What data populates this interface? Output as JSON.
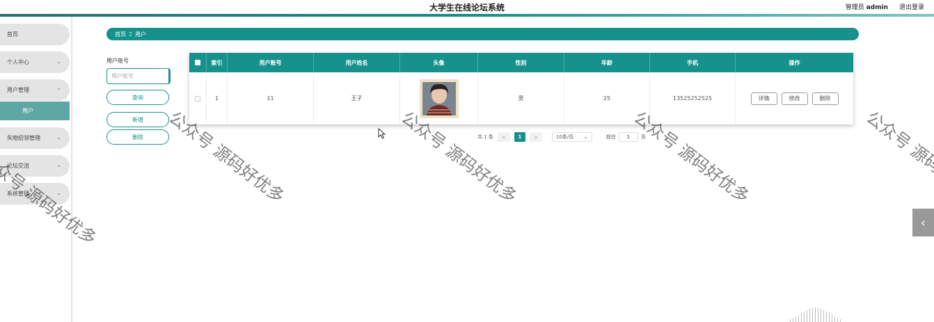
{
  "header": {
    "title": "大学生在线论坛系统",
    "role": "管理员",
    "username": "admin",
    "logout": "退出登录"
  },
  "colors": {
    "primary": "#17918c",
    "menu_bg": "#e4e4e4",
    "menu_active": "#5ea7a4"
  },
  "sidebar": {
    "items": [
      {
        "label": "首页",
        "chevron": ""
      },
      {
        "label": "个人中心",
        "chevron": "⌄"
      },
      {
        "label": "用户管理",
        "chevron": "⌃"
      },
      {
        "label": "失物招领管理",
        "chevron": "⌄"
      },
      {
        "label": "论坛交流",
        "chevron": "⌄"
      },
      {
        "label": "系统管理",
        "chevron": "⌄"
      }
    ],
    "active_sub": "用户"
  },
  "breadcrumb": {
    "home": "首页",
    "separator": "Ξ",
    "current": "用户"
  },
  "search": {
    "label": "用户账号",
    "placeholder": "用户账号",
    "query_button": "查询",
    "add_button": "新增",
    "delete_button": "删除"
  },
  "table": {
    "columns": [
      "索引",
      "用户账号",
      "用户姓名",
      "头像",
      "性别",
      "年龄",
      "手机",
      "操作"
    ],
    "rows": [
      {
        "index": "1",
        "account": "11",
        "name": "王子",
        "avatar_icon": "avatar-photo",
        "gender": "男",
        "age": "25",
        "phone": "13525252525"
      }
    ],
    "actions": {
      "detail": "详情",
      "edit": "修改",
      "delete": "删除"
    }
  },
  "pagination": {
    "total": "共 1 条",
    "prev": "<",
    "current_page": "1",
    "next": ">",
    "page_size": "10条/页",
    "goto_label": "前往",
    "goto_value": "1",
    "page_unit": "页"
  },
  "watermark": {
    "text": "公众号 源码好优多"
  },
  "side_toggle": "‹"
}
